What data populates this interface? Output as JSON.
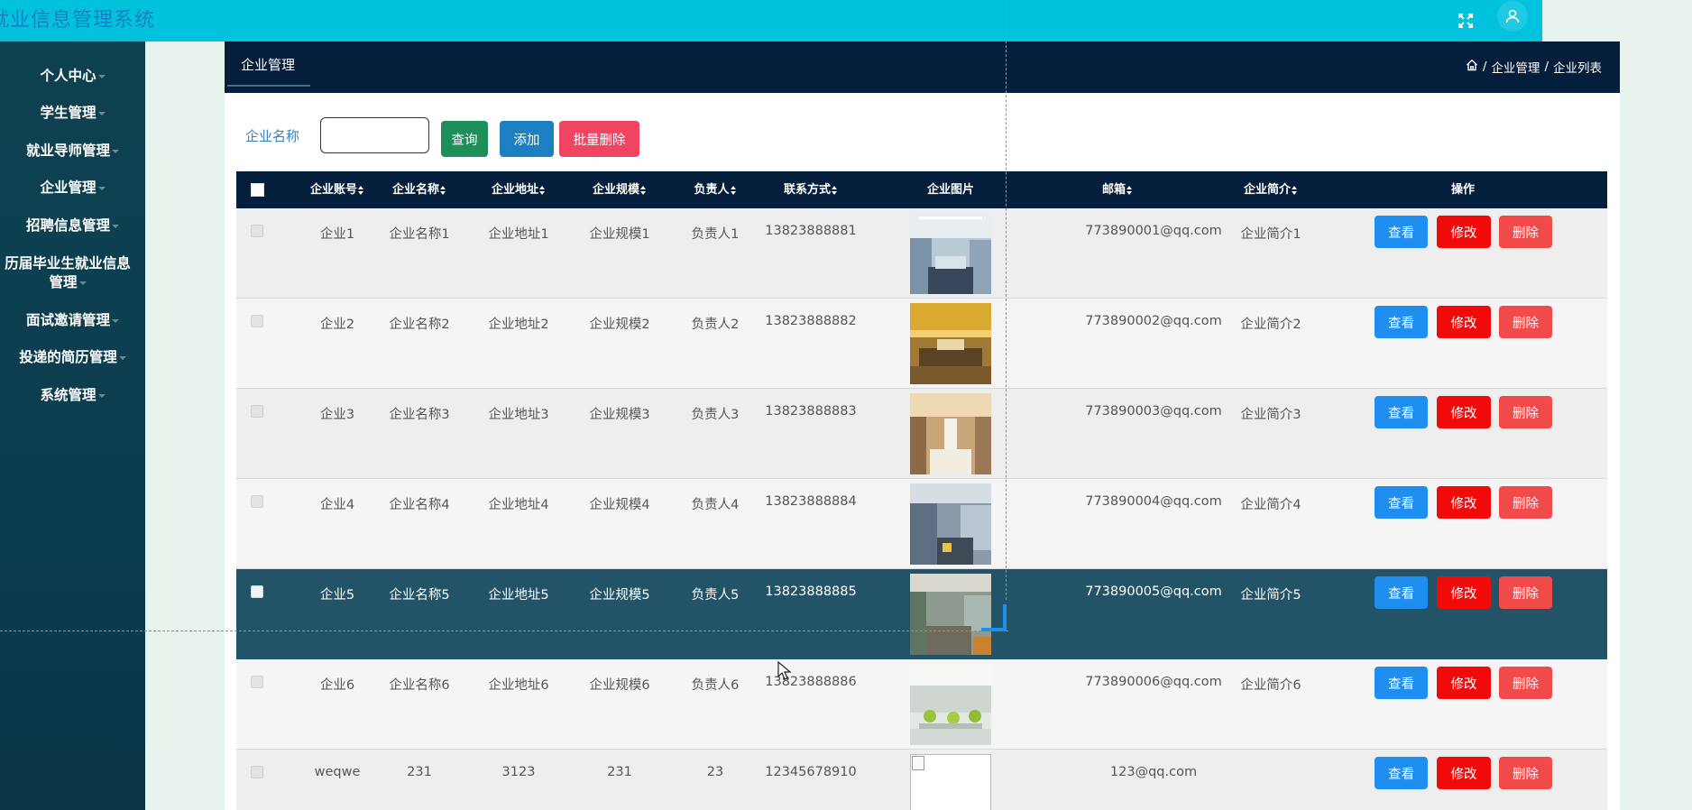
{
  "header": {
    "title": "就业信息管理系统",
    "fullscreen_icon": "expand-icon",
    "user_icon": "user-icon"
  },
  "sidebar": {
    "items": [
      {
        "label": "个人中心"
      },
      {
        "label": "学生管理"
      },
      {
        "label": "就业导师管理"
      },
      {
        "label": "企业管理"
      },
      {
        "label": "招聘信息管理"
      },
      {
        "label": "历届毕业生就业信息",
        "label2": "管理"
      },
      {
        "label": "面试邀请管理"
      },
      {
        "label": "投递的简历管理"
      },
      {
        "label": "系统管理"
      }
    ]
  },
  "tabs": {
    "active": "企业管理"
  },
  "breadcrumb": {
    "home_icon": "home-icon",
    "sep": "/",
    "level1": "企业管理",
    "level2": "企业列表"
  },
  "search": {
    "label": "企业名称",
    "value": "",
    "query_label": "查询",
    "add_label": "添加",
    "batch_delete_label": "批量删除"
  },
  "table": {
    "columns": [
      "企业账号",
      "企业名称",
      "企业地址",
      "企业规模",
      "负责人",
      "联系方式",
      "企业图片",
      "邮箱",
      "企业简介",
      "操作"
    ],
    "rows": [
      {
        "account": "企业1",
        "name": "企业名称1",
        "address": "企业地址1",
        "scale": "企业规模1",
        "owner": "负责人1",
        "phone": "13823888881",
        "image": "office-photo-1",
        "email": "773890001@qq.com",
        "intro": "企业简介1"
      },
      {
        "account": "企业2",
        "name": "企业名称2",
        "address": "企业地址2",
        "scale": "企业规模2",
        "owner": "负责人2",
        "phone": "13823888882",
        "image": "office-photo-2",
        "email": "773890002@qq.com",
        "intro": "企业简介2"
      },
      {
        "account": "企业3",
        "name": "企业名称3",
        "address": "企业地址3",
        "scale": "企业规模3",
        "owner": "负责人3",
        "phone": "13823888883",
        "image": "office-photo-3",
        "email": "773890003@qq.com",
        "intro": "企业简介3"
      },
      {
        "account": "企业4",
        "name": "企业名称4",
        "address": "企业地址4",
        "scale": "企业规模4",
        "owner": "负责人4",
        "phone": "13823888884",
        "image": "office-photo-4",
        "email": "773890004@qq.com",
        "intro": "企业简介4"
      },
      {
        "account": "企业5",
        "name": "企业名称5",
        "address": "企业地址5",
        "scale": "企业规模5",
        "owner": "负责人5",
        "phone": "13823888885",
        "image": "office-photo-5",
        "email": "773890005@qq.com",
        "intro": "企业简介5"
      },
      {
        "account": "企业6",
        "name": "企业名称6",
        "address": "企业地址6",
        "scale": "企业规模6",
        "owner": "负责人6",
        "phone": "13823888886",
        "image": "office-photo-6",
        "email": "773890006@qq.com",
        "intro": "企业简介6"
      },
      {
        "account": "weqwe",
        "name": "231",
        "address": "3123",
        "scale": "231",
        "owner": "23",
        "phone": "12345678910",
        "image": "broken-image",
        "email": "123@qq.com",
        "intro": ""
      }
    ],
    "actions": {
      "view": "查看",
      "edit": "修改",
      "delete": "删除"
    }
  },
  "colors": {
    "topbar": "#00c2dd",
    "sidebar": "#0e4150",
    "header_dark": "#041e3b",
    "highlight_row": "#235367",
    "view_btn": "#1e8ef0",
    "edit_btn": "#f00a0a",
    "delete_btn": "#f04a4a",
    "batch_delete_btn": "#f04462",
    "query_btn": "#1e8f5a",
    "add_btn": "#1b7fc2"
  }
}
